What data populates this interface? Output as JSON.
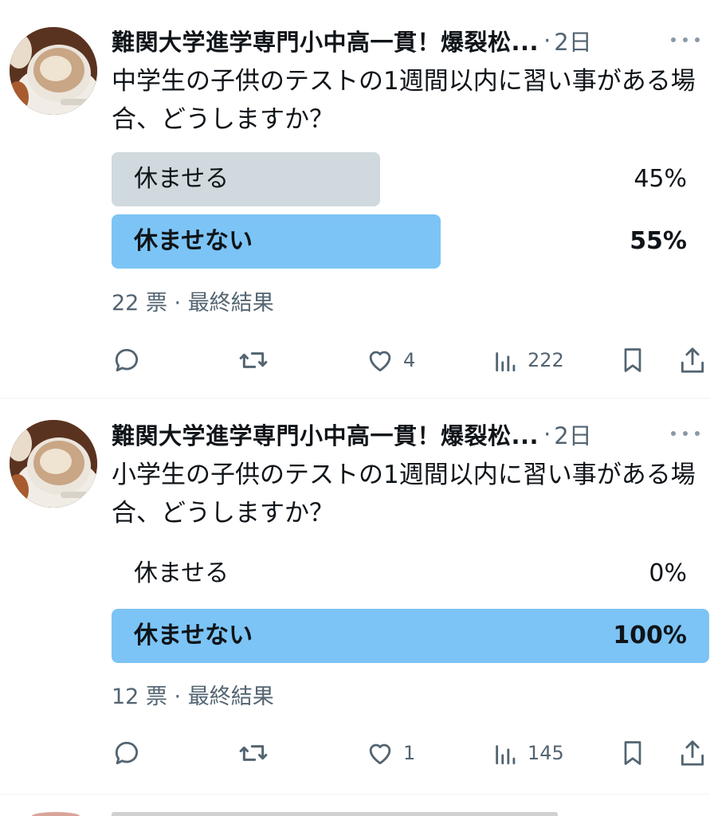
{
  "tweets": [
    {
      "author": "難関大学進学専門小中高一貫！爆裂松...",
      "separator": "·",
      "time": "2日",
      "text": "中学生の子供のテストの1週間以内に習い事がある場合、どうしますか？",
      "poll": {
        "options": [
          {
            "label": "休ませる",
            "percent_text": "45%",
            "percent": 45,
            "winner": false
          },
          {
            "label": "休ませない",
            "percent_text": "55%",
            "percent": 55,
            "winner": true
          }
        ],
        "votes": "22 票",
        "meta_separator": " · ",
        "status": "最終結果"
      },
      "actions": {
        "reply_count": "",
        "retweet_count": "",
        "like_count": "4",
        "views_count": "222"
      }
    },
    {
      "author": "難関大学進学専門小中高一貫！爆裂松...",
      "separator": "·",
      "time": "2日",
      "text": "小学生の子供のテストの1週間以内に習い事がある場合、どうしますか？",
      "poll": {
        "options": [
          {
            "label": "休ませる",
            "percent_text": "0%",
            "percent": 0,
            "winner": false
          },
          {
            "label": "休ませない",
            "percent_text": "100%",
            "percent": 100,
            "winner": true
          }
        ],
        "votes": "12 票",
        "meta_separator": " · ",
        "status": "最終結果"
      },
      "actions": {
        "reply_count": "",
        "retweet_count": "",
        "like_count": "1",
        "views_count": "145"
      }
    }
  ],
  "colors": {
    "winner_bar": "#7cc4f5",
    "loser_bar": "#cfd9de",
    "secondary_text": "#536471",
    "primary_text": "#0f1419"
  },
  "icons": [
    "reply-icon",
    "retweet-icon",
    "like-icon",
    "views-icon",
    "bookmark-icon",
    "share-icon",
    "more-icon"
  ]
}
